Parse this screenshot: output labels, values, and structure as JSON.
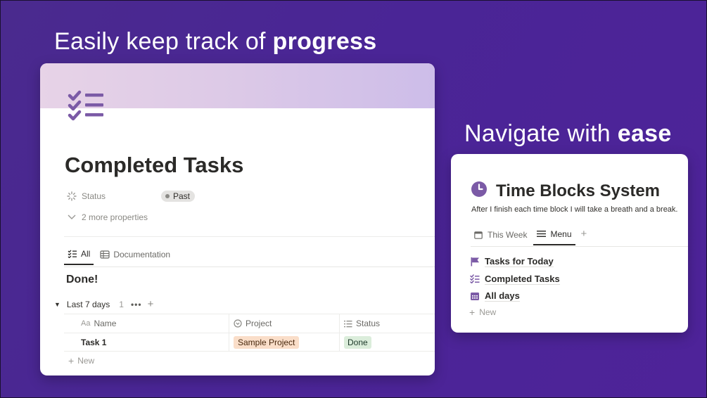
{
  "headlines": {
    "left_plain": "Easily keep track of ",
    "left_bold": "progress",
    "right_plain": "Navigate with ",
    "right_bold": "ease"
  },
  "left_page": {
    "icon": "checklist-icon",
    "title": "Completed Tasks",
    "properties": {
      "status_label": "Status",
      "status_value": "Past",
      "more_properties": "2 more properties"
    },
    "tabs": [
      {
        "label": "All",
        "icon": "checklist-icon",
        "active": true
      },
      {
        "label": "Documentation",
        "icon": "table-icon",
        "active": false
      }
    ],
    "group_title": "Done!",
    "group": {
      "label": "Last 7 days",
      "count": "1",
      "more": "•••",
      "add": "+"
    },
    "table": {
      "columns": [
        {
          "label": "Name",
          "icon": "Aa"
        },
        {
          "label": "Project",
          "icon": "relation-icon"
        },
        {
          "label": "Status",
          "icon": "list-icon"
        }
      ],
      "rows": [
        {
          "name": "Task 1",
          "project": "Sample Project",
          "status": "Done"
        }
      ],
      "new_label": "New"
    },
    "colors": {
      "project_tag": "#fadec9",
      "done_tag": "#dbeddb",
      "accent": "#7b5aa6"
    }
  },
  "right_page": {
    "icon": "clock-icon",
    "title": "Time Blocks System",
    "description": "After I finish each time block I will take a breath and a break.",
    "tabs": [
      {
        "label": "This Week",
        "icon": "calendar-icon",
        "active": false
      },
      {
        "label": "Menu",
        "icon": "menu-icon",
        "active": true
      }
    ],
    "add_tab": "+",
    "menu_items": [
      {
        "label": "Tasks for Today",
        "icon": "flag-icon"
      },
      {
        "label": "Completed Tasks",
        "icon": "checklist-icon"
      },
      {
        "label": "All days",
        "icon": "calendar-icon"
      }
    ],
    "new_label": "New"
  }
}
